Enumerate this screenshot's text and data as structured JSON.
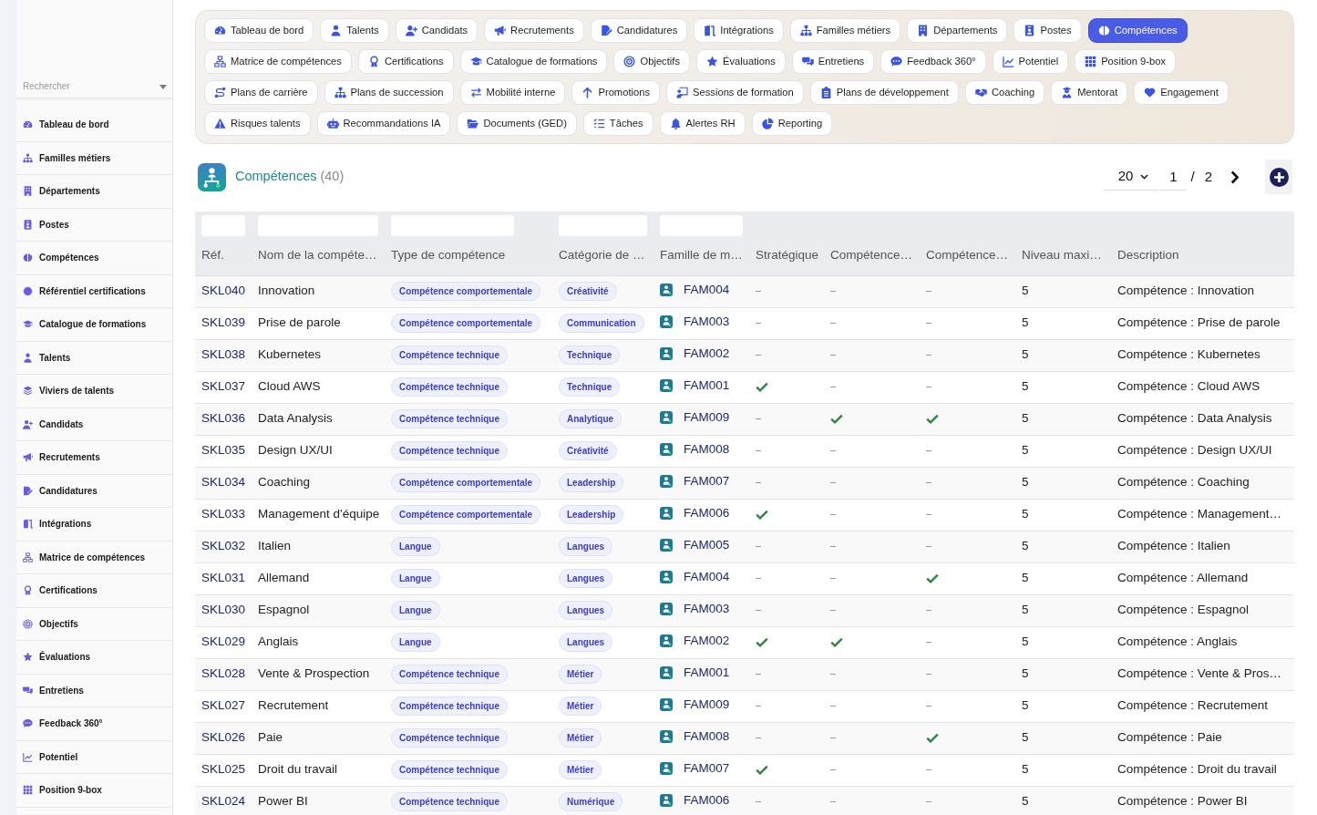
{
  "sidebar": {
    "search": {
      "placeholder": "Rechercher"
    },
    "items": [
      "Tableau de bord",
      "Familles métiers",
      "Départements",
      "Postes",
      "Compétences",
      "Référentiel certifications",
      "Catalogue de formations",
      "Talents",
      "Viviers de talents",
      "Candidats",
      "Recrutements",
      "Candidatures",
      "Intégrations",
      "Matrice de compétences",
      "Certifications",
      "Objectifs",
      "Évaluations",
      "Entretiens",
      "Feedback 360°",
      "Potentiel",
      "Position 9-box"
    ]
  },
  "nav": {
    "chips": [
      {
        "label": "Tableau de bord",
        "selected": false
      },
      {
        "label": "Talents",
        "selected": false
      },
      {
        "label": "Candidats",
        "selected": false
      },
      {
        "label": "Recrutements",
        "selected": false
      },
      {
        "label": "Candidatures",
        "selected": false
      },
      {
        "label": "Intégrations",
        "selected": false
      },
      {
        "label": "Familles métiers",
        "selected": false
      },
      {
        "label": "Départements",
        "selected": false
      },
      {
        "label": "Postes",
        "selected": false
      },
      {
        "label": "Compétences",
        "selected": true
      },
      {
        "label": "Matrice de compétences",
        "selected": false
      },
      {
        "label": "Certifications",
        "selected": false
      },
      {
        "label": "Catalogue de formations",
        "selected": false
      },
      {
        "label": "Objectifs",
        "selected": false
      },
      {
        "label": "Évaluations",
        "selected": false
      },
      {
        "label": "Entretiens",
        "selected": false
      },
      {
        "label": "Feedback 360°",
        "selected": false
      },
      {
        "label": "Potentiel",
        "selected": false
      },
      {
        "label": "Position 9-box",
        "selected": false
      },
      {
        "label": "Plans de carrière",
        "selected": false
      },
      {
        "label": "Plans de succession",
        "selected": false
      },
      {
        "label": "Mobilité interne",
        "selected": false
      },
      {
        "label": "Promotions",
        "selected": false
      },
      {
        "label": "Sessions de formation",
        "selected": false
      },
      {
        "label": "Plans de développement",
        "selected": false
      },
      {
        "label": "Coaching",
        "selected": false
      },
      {
        "label": "Mentorat",
        "selected": false
      },
      {
        "label": "Engagement",
        "selected": false
      },
      {
        "label": "Risques talents",
        "selected": false
      },
      {
        "label": "Recommandations IA",
        "selected": false
      },
      {
        "label": "Documents (GED)",
        "selected": false
      },
      {
        "label": "Tâches",
        "selected": false
      },
      {
        "label": "Alertes RH",
        "selected": false
      },
      {
        "label": "Reporting",
        "selected": false
      }
    ]
  },
  "page": {
    "title": "Compétences",
    "count": "(40)"
  },
  "pagination": {
    "page_size": "20",
    "page": "1",
    "separator": "/",
    "total_pages": "2"
  },
  "table": {
    "columns": [
      {
        "label": "Réf.",
        "filter": true
      },
      {
        "label": "Nom de la compéte…",
        "filter": true
      },
      {
        "label": "Type de compétence",
        "filter": true
      },
      {
        "label": "Catégorie de …",
        "filter": true
      },
      {
        "label": "Famille de m…",
        "filter": true
      },
      {
        "label": "Stratégique",
        "filter": false
      },
      {
        "label": "Compétence…",
        "filter": false
      },
      {
        "label": "Compétence…",
        "filter": false
      },
      {
        "label": "Niveau maxi…",
        "filter": false
      },
      {
        "label": "Description",
        "filter": false
      }
    ],
    "rows": [
      {
        "ref": "SKL040",
        "name": "Innovation",
        "type": "Compétence comportementale",
        "category": "Créativité",
        "family": "FAM004",
        "strategique": false,
        "column_8": false,
        "column_9": false,
        "max_level": "5",
        "description": "Compétence : Innovation"
      },
      {
        "ref": "SKL039",
        "name": "Prise de parole",
        "type": "Compétence comportementale",
        "category": "Communication",
        "family": "FAM003",
        "strategique": false,
        "column_8": false,
        "column_9": false,
        "max_level": "5",
        "description": "Compétence : Prise de parole"
      },
      {
        "ref": "SKL038",
        "name": "Kubernetes",
        "type": "Compétence technique",
        "category": "Technique",
        "family": "FAM002",
        "strategique": false,
        "column_8": false,
        "column_9": false,
        "max_level": "5",
        "description": "Compétence : Kubernetes"
      },
      {
        "ref": "SKL037",
        "name": "Cloud AWS",
        "type": "Compétence technique",
        "category": "Technique",
        "family": "FAM001",
        "strategique": true,
        "column_8": false,
        "column_9": false,
        "max_level": "5",
        "description": "Compétence : Cloud AWS"
      },
      {
        "ref": "SKL036",
        "name": "Data Analysis",
        "type": "Compétence technique",
        "category": "Analytique",
        "family": "FAM009",
        "strategique": false,
        "column_8": true,
        "column_9": true,
        "max_level": "5",
        "description": "Compétence : Data Analysis"
      },
      {
        "ref": "SKL035",
        "name": "Design UX/UI",
        "type": "Compétence technique",
        "category": "Créativité",
        "family": "FAM008",
        "strategique": false,
        "column_8": false,
        "column_9": false,
        "max_level": "5",
        "description": "Compétence : Design UX/UI"
      },
      {
        "ref": "SKL034",
        "name": "Coaching",
        "type": "Compétence comportementale",
        "category": "Leadership",
        "family": "FAM007",
        "strategique": false,
        "column_8": false,
        "column_9": false,
        "max_level": "5",
        "description": "Compétence : Coaching"
      },
      {
        "ref": "SKL033",
        "name": "Management d'équipe",
        "type": "Compétence comportementale",
        "category": "Leadership",
        "family": "FAM006",
        "strategique": true,
        "column_8": false,
        "column_9": false,
        "max_level": "5",
        "description": "Compétence : Management…"
      },
      {
        "ref": "SKL032",
        "name": "Italien",
        "type": "Langue",
        "category": "Langues",
        "family": "FAM005",
        "strategique": false,
        "column_8": false,
        "column_9": false,
        "max_level": "5",
        "description": "Compétence : Italien"
      },
      {
        "ref": "SKL031",
        "name": "Allemand",
        "type": "Langue",
        "category": "Langues",
        "family": "FAM004",
        "strategique": false,
        "column_8": false,
        "column_9": true,
        "max_level": "5",
        "description": "Compétence : Allemand"
      },
      {
        "ref": "SKL030",
        "name": "Espagnol",
        "type": "Langue",
        "category": "Langues",
        "family": "FAM003",
        "strategique": false,
        "column_8": false,
        "column_9": false,
        "max_level": "5",
        "description": "Compétence : Espagnol"
      },
      {
        "ref": "SKL029",
        "name": "Anglais",
        "type": "Langue",
        "category": "Langues",
        "family": "FAM002",
        "strategique": true,
        "column_8": true,
        "column_9": false,
        "max_level": "5",
        "description": "Compétence : Anglais"
      },
      {
        "ref": "SKL028",
        "name": "Vente & Prospection",
        "type": "Compétence technique",
        "category": "Métier",
        "family": "FAM001",
        "strategique": false,
        "column_8": false,
        "column_9": false,
        "max_level": "5",
        "description": "Compétence : Vente & Pros…"
      },
      {
        "ref": "SKL027",
        "name": "Recrutement",
        "type": "Compétence technique",
        "category": "Métier",
        "family": "FAM009",
        "strategique": false,
        "column_8": false,
        "column_9": false,
        "max_level": "5",
        "description": "Compétence : Recrutement"
      },
      {
        "ref": "SKL026",
        "name": "Paie",
        "type": "Compétence technique",
        "category": "Métier",
        "family": "FAM008",
        "strategique": false,
        "column_8": false,
        "column_9": true,
        "max_level": "5",
        "description": "Compétence : Paie"
      },
      {
        "ref": "SKL025",
        "name": "Droit du travail",
        "type": "Compétence technique",
        "category": "Métier",
        "family": "FAM007",
        "strategique": true,
        "column_8": false,
        "column_9": false,
        "max_level": "5",
        "description": "Compétence : Droit du travail"
      },
      {
        "ref": "SKL024",
        "name": "Power BI",
        "type": "Compétence technique",
        "category": "Numérique",
        "family": "FAM006",
        "strategique": false,
        "column_8": false,
        "column_9": false,
        "max_level": "5",
        "description": "Compétence : Power BI"
      }
    ]
  }
}
